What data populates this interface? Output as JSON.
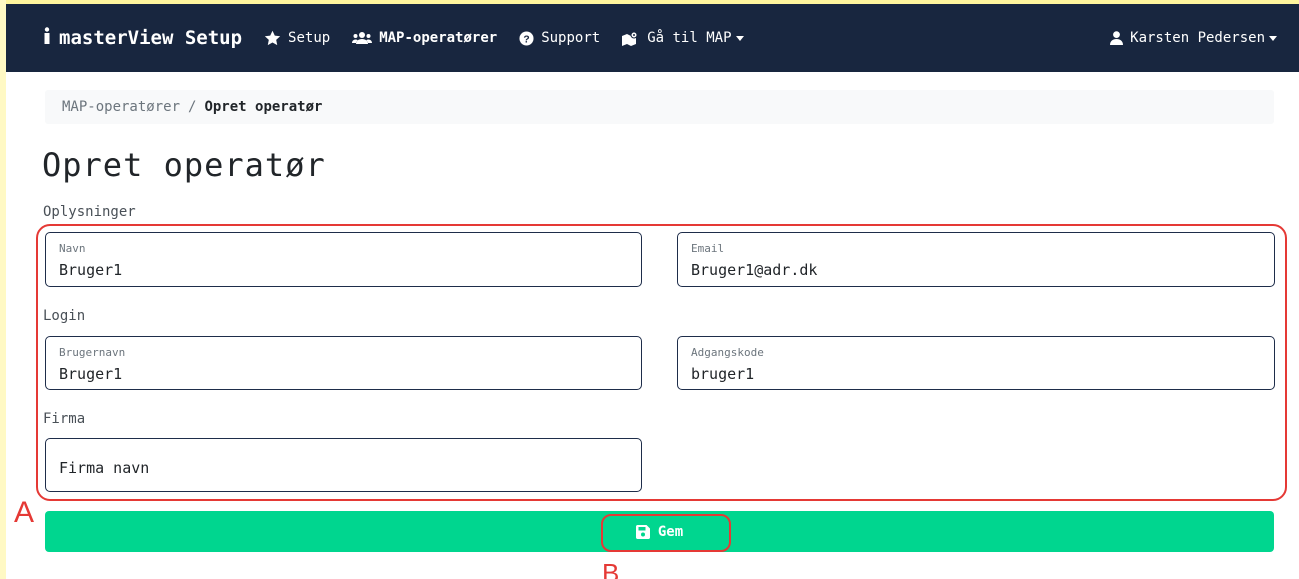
{
  "navbar": {
    "brand": "masterView Setup",
    "items": [
      {
        "label": "Setup",
        "icon": "star-icon"
      },
      {
        "label": "MAP-operatører",
        "icon": "users-icon",
        "active": true
      },
      {
        "label": "Support",
        "icon": "question-circle-icon"
      },
      {
        "label": "Gå til MAP",
        "icon": "map-icon",
        "dropdown": true
      }
    ],
    "user": {
      "label": "Karsten Pedersen",
      "icon": "user-icon",
      "dropdown": true
    }
  },
  "breadcrumb": {
    "parent": "MAP-operatører",
    "separator": "/",
    "current": "Opret operatør"
  },
  "page_title": "Opret operatør",
  "sections": {
    "oplysninger": {
      "label": "Oplysninger",
      "navn": {
        "label": "Navn",
        "value": "Bruger1"
      },
      "email": {
        "label": "Email",
        "value": "Bruger1@adr.dk"
      }
    },
    "login": {
      "label": "Login",
      "brugernavn": {
        "label": "Brugernavn",
        "value": "Bruger1"
      },
      "adgangskode": {
        "label": "Adgangskode",
        "value": "bruger1"
      }
    },
    "firma": {
      "label": "Firma",
      "firma_navn": {
        "placeholder": "Firma navn",
        "value": ""
      }
    }
  },
  "save_button": {
    "label": "Gem",
    "icon": "save-icon"
  },
  "annotations": {
    "a": "A",
    "b": "B"
  },
  "colors": {
    "navbar": "#18263f",
    "save_button": "#00d68f",
    "annotation": "#e53935",
    "field_border": "#1e2d4a"
  }
}
